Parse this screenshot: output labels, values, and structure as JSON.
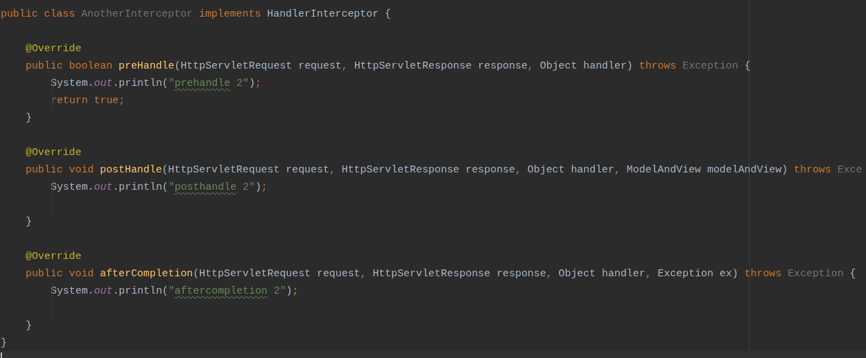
{
  "code": [
    {
      "kind": "code",
      "tokens": [
        {
          "text": "public class ",
          "kind": "kw"
        },
        {
          "text": "AnotherInterceptor",
          "kind": "unused"
        },
        {
          "text": " implements ",
          "kind": "kw"
        },
        {
          "text": "HandlerInterceptor {",
          "kind": "plain"
        }
      ],
      "children": [
        {
          "kind": "blank"
        },
        {
          "kind": "code",
          "tokens": [
            {
              "text": "@Override",
              "kind": "ann"
            }
          ]
        },
        {
          "kind": "code",
          "tokens": [
            {
              "text": "public boolean ",
              "kind": "kw"
            },
            {
              "text": "preHandle",
              "kind": "method"
            },
            {
              "text": "(HttpServletRequest request",
              "kind": "plain"
            },
            {
              "text": ", ",
              "kind": "punct"
            },
            {
              "text": "HttpServletResponse response",
              "kind": "plain"
            },
            {
              "text": ", ",
              "kind": "punct"
            },
            {
              "text": "Object handler) ",
              "kind": "plain"
            },
            {
              "text": "throws ",
              "kind": "kw"
            },
            {
              "text": "Exception ",
              "kind": "unused"
            },
            {
              "text": "{",
              "kind": "plain"
            }
          ],
          "children": [
            {
              "kind": "code",
              "tokens": [
                {
                  "text": "System.",
                  "kind": "plain"
                },
                {
                  "text": "out",
                  "kind": "field"
                },
                {
                  "text": ".println(",
                  "kind": "plain"
                },
                {
                  "text": "\"",
                  "kind": "str"
                },
                {
                  "text": "prehandle",
                  "kind": "typo"
                },
                {
                  "text": " 2\"",
                  "kind": "str"
                },
                {
                  "text": ")",
                  "kind": "plain"
                },
                {
                  "text": ";",
                  "kind": "punct"
                }
              ]
            },
            {
              "kind": "code",
              "tokens": [
                {
                  "text": "return true;",
                  "kind": "kw"
                }
              ]
            }
          ]
        },
        {
          "kind": "code",
          "tokens": [
            {
              "text": "}",
              "kind": "plain"
            }
          ]
        },
        {
          "kind": "blank"
        },
        {
          "kind": "code",
          "tokens": [
            {
              "text": "@Override",
              "kind": "ann"
            }
          ]
        },
        {
          "kind": "code",
          "tokens": [
            {
              "text": "public void ",
              "kind": "kw"
            },
            {
              "text": "postHandle",
              "kind": "method"
            },
            {
              "text": "(HttpServletRequest request",
              "kind": "plain"
            },
            {
              "text": ", ",
              "kind": "punct"
            },
            {
              "text": "HttpServletResponse response",
              "kind": "plain"
            },
            {
              "text": ", ",
              "kind": "punct"
            },
            {
              "text": "Object handler",
              "kind": "plain"
            },
            {
              "text": ", ",
              "kind": "punct"
            },
            {
              "text": "ModelAndView modelAndView) ",
              "kind": "plain"
            },
            {
              "text": "throws ",
              "kind": "kw"
            },
            {
              "text": "Exce",
              "kind": "unused"
            }
          ],
          "children": [
            {
              "kind": "code",
              "tokens": [
                {
                  "text": "System.",
                  "kind": "plain"
                },
                {
                  "text": "out",
                  "kind": "field"
                },
                {
                  "text": ".println(",
                  "kind": "plain"
                },
                {
                  "text": "\"",
                  "kind": "str"
                },
                {
                  "text": "posthandle",
                  "kind": "typo"
                },
                {
                  "text": " 2\"",
                  "kind": "str"
                },
                {
                  "text": ")",
                  "kind": "plain"
                },
                {
                  "text": ";",
                  "kind": "punct"
                }
              ]
            },
            {
              "kind": "blank"
            }
          ]
        },
        {
          "kind": "code",
          "tokens": [
            {
              "text": "}",
              "kind": "plain"
            }
          ]
        },
        {
          "kind": "blank"
        },
        {
          "kind": "code",
          "tokens": [
            {
              "text": "@Override",
              "kind": "ann"
            }
          ]
        },
        {
          "kind": "code",
          "tokens": [
            {
              "text": "public void ",
              "kind": "kw"
            },
            {
              "text": "afterCompletion",
              "kind": "method"
            },
            {
              "text": "(HttpServletRequest request",
              "kind": "plain"
            },
            {
              "text": ", ",
              "kind": "punct"
            },
            {
              "text": "HttpServletResponse response",
              "kind": "plain"
            },
            {
              "text": ", ",
              "kind": "punct"
            },
            {
              "text": "Object handler",
              "kind": "plain"
            },
            {
              "text": ", ",
              "kind": "punct"
            },
            {
              "text": "Exception ex) ",
              "kind": "plain"
            },
            {
              "text": "throws ",
              "kind": "kw"
            },
            {
              "text": "Exception ",
              "kind": "unused"
            },
            {
              "text": "{",
              "kind": "plain"
            }
          ],
          "children": [
            {
              "kind": "code",
              "tokens": [
                {
                  "text": "System.",
                  "kind": "plain"
                },
                {
                  "text": "out",
                  "kind": "field"
                },
                {
                  "text": ".println(",
                  "kind": "plain"
                },
                {
                  "text": "\"",
                  "kind": "str"
                },
                {
                  "text": "aftercompletion",
                  "kind": "typo"
                },
                {
                  "text": " 2\"",
                  "kind": "str"
                },
                {
                  "text": ")",
                  "kind": "plain"
                },
                {
                  "text": ";",
                  "kind": "punct"
                }
              ]
            },
            {
              "kind": "blank"
            }
          ]
        },
        {
          "kind": "code",
          "tokens": [
            {
              "text": "}",
              "kind": "plain"
            }
          ]
        }
      ]
    },
    {
      "kind": "code",
      "tokens": [
        {
          "text": "}",
          "kind": "plain"
        }
      ]
    }
  ]
}
